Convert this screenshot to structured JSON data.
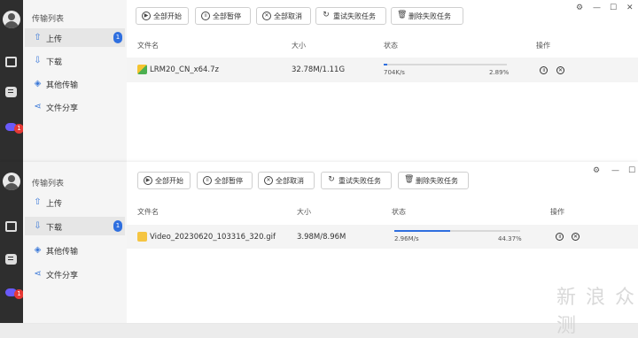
{
  "windows": [
    {
      "sidebar": {
        "title": "传输列表",
        "items": [
          {
            "label": "上传",
            "icon": "upload-icon",
            "badge": "1",
            "active": true
          },
          {
            "label": "下载",
            "icon": "download-icon",
            "badge": "",
            "active": false
          },
          {
            "label": "其他传输",
            "icon": "other-transfer-icon",
            "badge": "",
            "active": false
          },
          {
            "label": "文件分享",
            "icon": "share-icon",
            "badge": "",
            "active": false
          }
        ]
      },
      "rail_badge": "1",
      "toolbar": {
        "start_all": "全部开始",
        "pause_all": "全部暂停",
        "cancel_all": "全部取消",
        "retry_failed": "重试失败任务",
        "delete_failed": "删除失败任务"
      },
      "columns": {
        "name": "文件名",
        "size": "大小",
        "status": "状态",
        "action": "操作"
      },
      "rows": [
        {
          "name": "LRM20_CN_x64.7z",
          "size": "32.78M/1.11G",
          "speed": "704K/s",
          "percent": "2.89%",
          "progress": 0.0289,
          "file_type": "archive"
        }
      ]
    },
    {
      "sidebar": {
        "title": "传输列表",
        "items": [
          {
            "label": "上传",
            "icon": "upload-icon",
            "badge": "",
            "active": false
          },
          {
            "label": "下载",
            "icon": "download-icon",
            "badge": "1",
            "active": true
          },
          {
            "label": "其他传输",
            "icon": "other-transfer-icon",
            "badge": "",
            "active": false
          },
          {
            "label": "文件分享",
            "icon": "share-icon",
            "badge": "",
            "active": false
          }
        ]
      },
      "rail_badge": "1",
      "toolbar": {
        "start_all": "全部开始",
        "pause_all": "全部暂停",
        "cancel_all": "全部取消",
        "retry_failed": "重试失败任务",
        "delete_failed": "删除失败任务"
      },
      "columns": {
        "name": "文件名",
        "size": "大小",
        "status": "状态",
        "action": "操作"
      },
      "rows": [
        {
          "name": "Video_20230620_103316_320.gif",
          "size": "3.98M/8.96M",
          "speed": "2.96M/s",
          "percent": "44.37%",
          "progress": 0.4437,
          "file_type": "image"
        }
      ]
    }
  ],
  "watermark": "新 浪 众 测",
  "colors": {
    "accent": "#2f6fdf",
    "badge_red": "#e53935",
    "rail": "#2e2e2e"
  }
}
